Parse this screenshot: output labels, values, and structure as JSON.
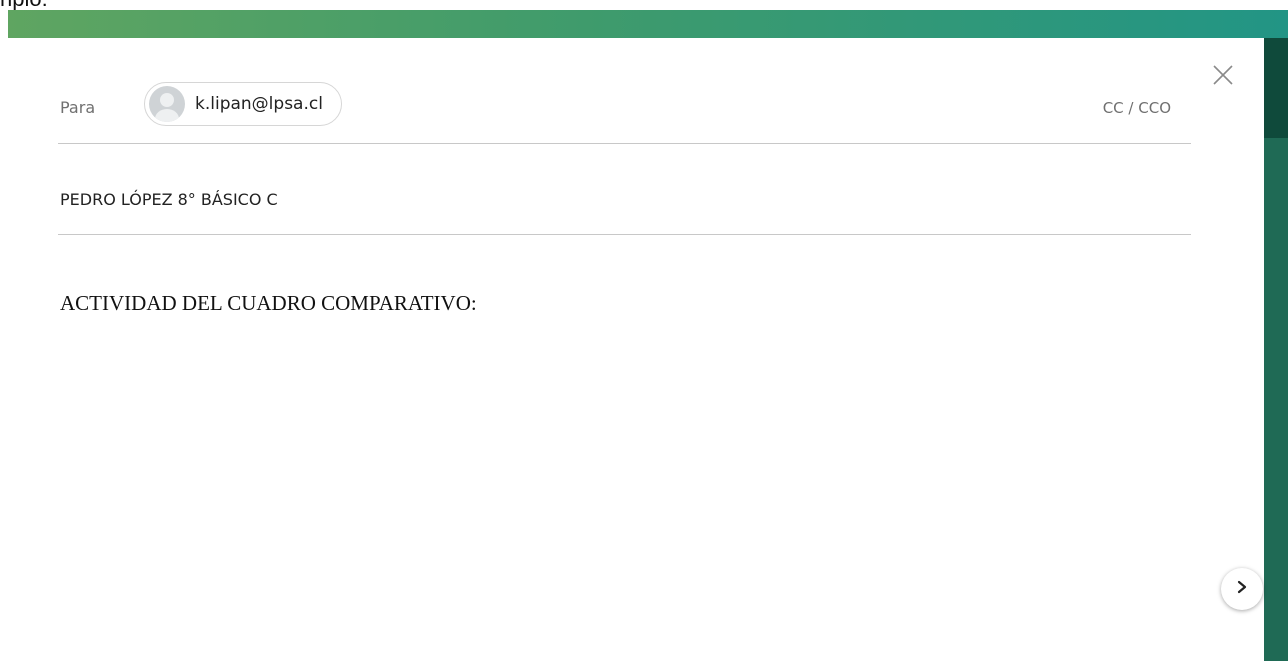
{
  "page_header": {
    "partial_text": "nplo:"
  },
  "compose": {
    "close_icon": "close-icon",
    "to": {
      "label": "Para",
      "recipients": [
        {
          "email": "k.lipan@lpsa.cl",
          "avatar_icon": "person-avatar-icon"
        }
      ],
      "cc_bcc_label": "CC / CCO"
    },
    "subject": {
      "value": "PEDRO LÓPEZ 8° BÁSICO C"
    },
    "body": {
      "text": "ACTIVIDAD DEL CUADRO COMPARATIVO:"
    },
    "next_button_icon": "chevron-right-icon"
  },
  "colors": {
    "header_gradient_start": "#5fa561",
    "header_gradient_end": "#229585",
    "side_strip": "#1f6a55",
    "divider": "#c8c8c8"
  }
}
